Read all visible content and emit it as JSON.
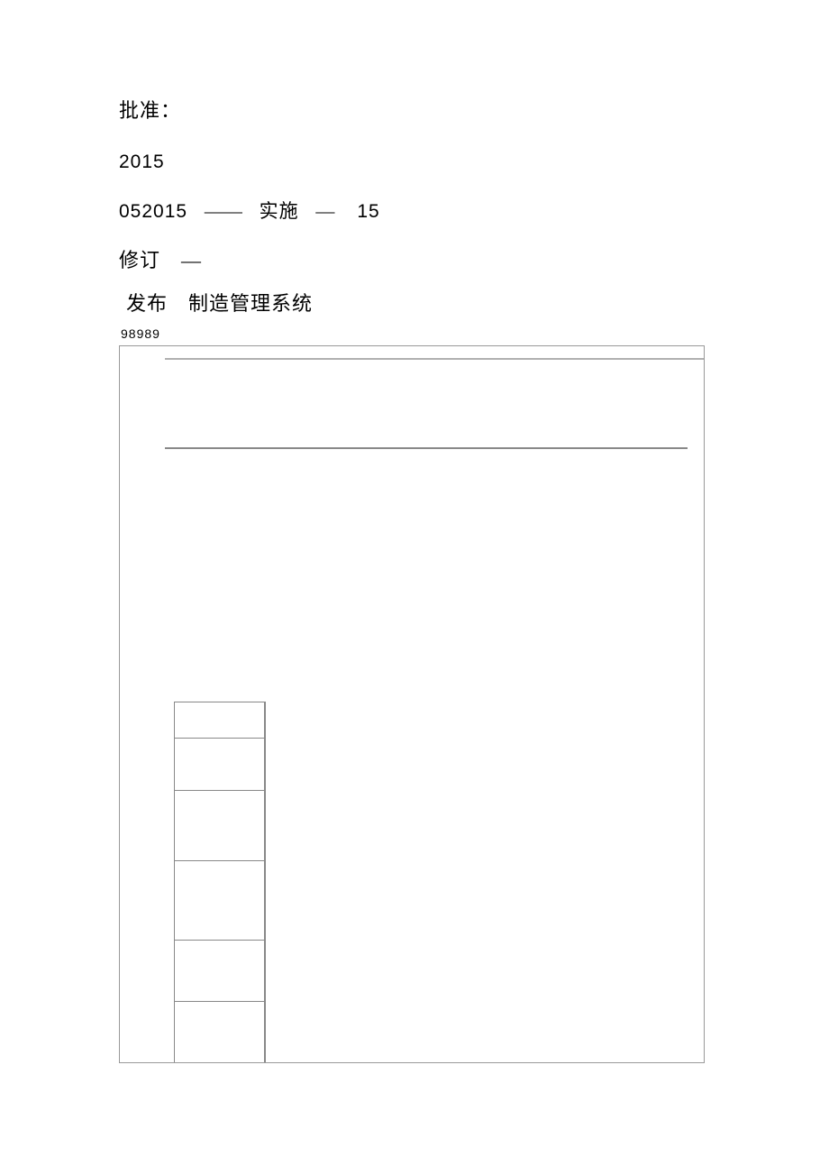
{
  "lines": {
    "l1": "批准：",
    "l2": "2015",
    "l3_a": "052015",
    "l3_b": "——",
    "l3_c": "实施",
    "l3_d": "—",
    "l3_e": "15",
    "l4": "修订　—",
    "l5": "发布　制造管理系统",
    "l6": "98989"
  }
}
